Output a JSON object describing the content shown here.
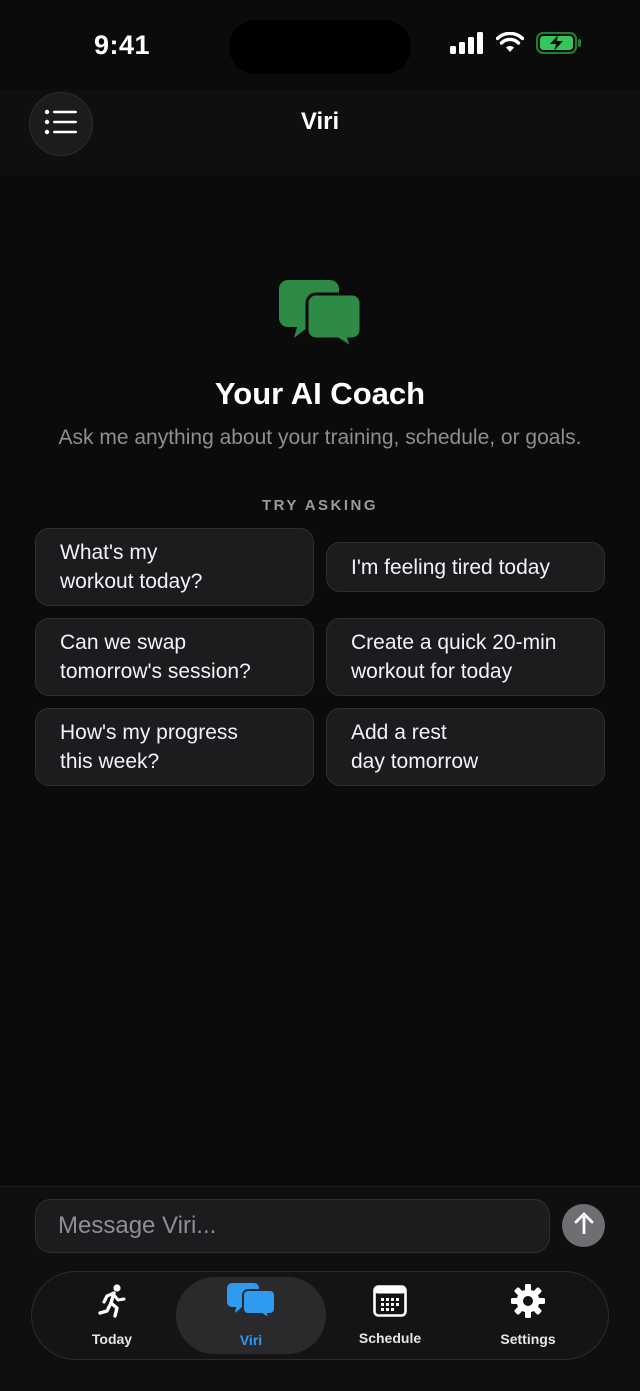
{
  "status_bar": {
    "time": "9:41"
  },
  "header": {
    "title": "Viri"
  },
  "hero": {
    "title": "Your AI Coach",
    "subtitle": "Ask me anything about your training, schedule, or goals."
  },
  "suggestions": {
    "label": "TRY ASKING",
    "items": [
      "What's my\nworkout today?",
      "I'm feeling tired today",
      "Can we swap\ntomorrow's session?",
      "Create a quick 20-min\nworkout for today",
      "How's my progress\nthis week?",
      "Add a rest\nday tomorrow"
    ]
  },
  "composer": {
    "placeholder": "Message Viri..."
  },
  "tabs": [
    {
      "label": "Today",
      "icon": "running-icon"
    },
    {
      "label": "Viri",
      "icon": "chat-bubbles-icon",
      "active": true
    },
    {
      "label": "Schedule",
      "icon": "calendar-icon"
    },
    {
      "label": "Settings",
      "icon": "gear-icon"
    }
  ],
  "colors": {
    "accent_green": "#2e8b45",
    "accent_blue": "#2e9bf0",
    "background": "#0b0b0b"
  }
}
